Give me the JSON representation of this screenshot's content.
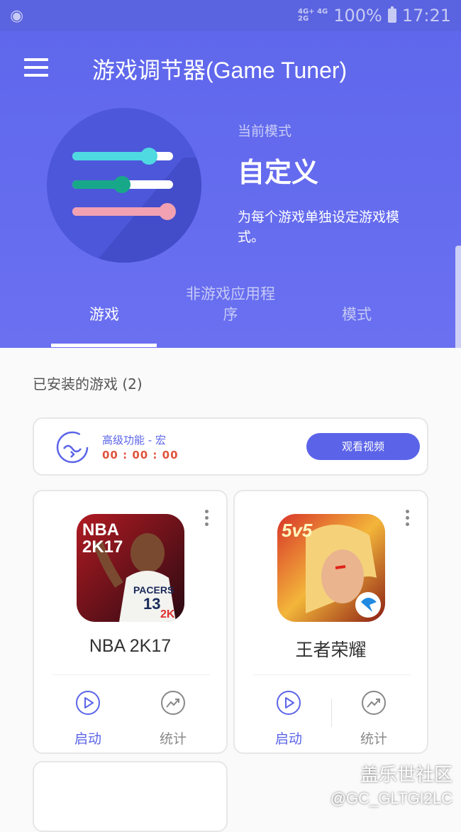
{
  "statusbar": {
    "network_top": "4G+ 4G",
    "network_bottom": "2G",
    "battery": "100%",
    "time": "17:21"
  },
  "header": {
    "title": "游戏调节器(Game Tuner)",
    "mode_label": "当前模式",
    "mode_name": "自定义",
    "mode_desc": "为每个游戏单独设定游戏模式。"
  },
  "tabs": [
    {
      "label": "游戏",
      "active": true
    },
    {
      "label": "非游戏应用程序",
      "active": false
    },
    {
      "label": "模式",
      "active": false
    }
  ],
  "content": {
    "installed_title": "已安装的游戏 (2)"
  },
  "promo": {
    "title": "高级功能 - 宏",
    "timer": "00 : 00 : 00",
    "button": "观看视频"
  },
  "games": [
    {
      "name": "NBA 2K17",
      "play": "启动",
      "stats": "统计",
      "icon_text": "NBA 2K17",
      "icon_sub": "PACERS 13"
    },
    {
      "name": "王者荣耀",
      "play": "启动",
      "stats": "统计",
      "icon_text": "5v5"
    }
  ],
  "watermark": {
    "line1": "盖乐世社区",
    "line2": "@GC_GLTGI2LC"
  },
  "colors": {
    "accent": "#5b64e8",
    "header": "#5f67ec",
    "timer": "#e0533c"
  }
}
